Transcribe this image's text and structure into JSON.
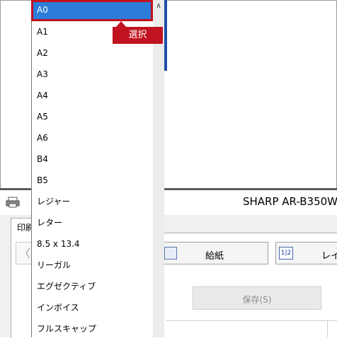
{
  "window": {
    "title": "SHARP AR-B350W",
    "tab_label": "印刷",
    "paper_button_label": "給紙",
    "layout_button_label": "レイ",
    "layout_icon_text": "1|2",
    "save_button_label": "保存(S)",
    "nav_arrow": "〈"
  },
  "dropdown": {
    "items": [
      "A0",
      "A1",
      "A2",
      "A3",
      "A4",
      "A5",
      "A6",
      "B4",
      "B5",
      "レジャー",
      "レター",
      "8.5 x 13.4",
      "リーガル",
      "エグゼクティブ",
      "インボイス",
      "フルスキャップ"
    ],
    "selected_index": 0,
    "scroll_up_glyph": "∧"
  },
  "annotation": {
    "callout_text": "選択",
    "highlight_color": "#c1121f"
  },
  "colors": {
    "selection": "#2d7cd9",
    "window_accent": "#1f4ea8"
  }
}
